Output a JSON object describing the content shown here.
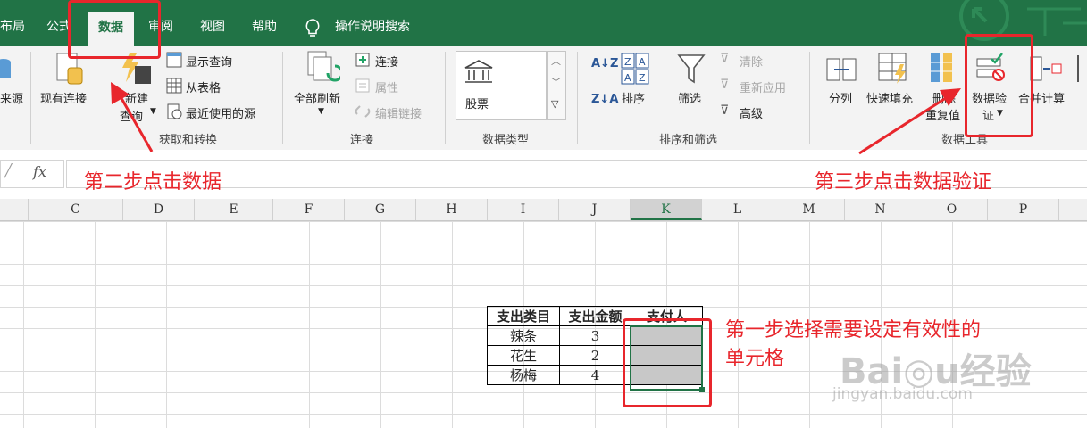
{
  "tabs": {
    "layout": "布局",
    "formula": "公式",
    "data": "数据",
    "review": "审阅",
    "view": "视图",
    "help": "帮助",
    "tell_me": "操作说明搜索"
  },
  "ribbon": {
    "get_transform": {
      "from_source": "来源",
      "existing_connections": "现有连接",
      "new_query_line1": "新建",
      "new_query_line2": "查询",
      "show_queries": "显示查询",
      "from_table": "从表格",
      "recent_sources": "最近使用的源",
      "label": "获取和转换"
    },
    "connections": {
      "refresh_all": "全部刷新",
      "connections": "连接",
      "properties": "属性",
      "edit_links": "编辑链接",
      "label": "连接"
    },
    "data_types": {
      "stocks": "股票",
      "label": "数据类型"
    },
    "sort_filter": {
      "sort": "排序",
      "filter": "筛选",
      "clear": "清除",
      "reapply": "重新应用",
      "advanced": "高级",
      "label": "排序和筛选"
    },
    "data_tools": {
      "text_to_columns": "分列",
      "flash_fill": "快速填充",
      "remove_dup_line1": "删除",
      "remove_dup_line2": "重复值",
      "validation_line1": "数据验",
      "validation_line2": "证",
      "consolidate": "合并计算",
      "label": "数据工具"
    }
  },
  "formula_bar": {
    "fx": "fx"
  },
  "columns": [
    "C",
    "D",
    "E",
    "F",
    "G",
    "H",
    "I",
    "J",
    "K",
    "L",
    "M",
    "N",
    "O",
    "P"
  ],
  "table": {
    "headers": [
      "支出类目",
      "支出金额",
      "支付人"
    ],
    "rows": [
      [
        "辣条",
        "3",
        ""
      ],
      [
        "花生",
        "2",
        ""
      ],
      [
        "杨梅",
        "4",
        ""
      ]
    ]
  },
  "annotations": {
    "step1_line1": "第一步选择需要设定有效性的",
    "step1_line2": "单元格",
    "step2": "第二步点击数据",
    "step3": "第三步点击数据验证"
  },
  "colors": {
    "excel_green": "#217346",
    "annotation_red": "#e8262c",
    "selection_gray": "#c8c8c8"
  }
}
